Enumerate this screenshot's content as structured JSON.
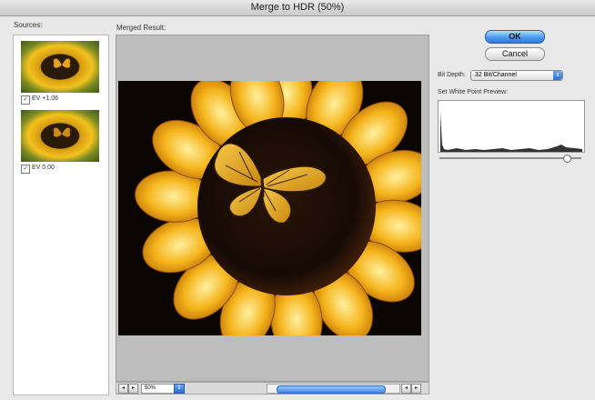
{
  "window": {
    "title": "Merge to HDR (50%)"
  },
  "sources": {
    "label": "Sources:",
    "items": [
      {
        "ev_label": "EV +1.06",
        "checked": true
      },
      {
        "ev_label": "EV 0.00",
        "checked": true
      }
    ]
  },
  "merged": {
    "label": "Merged Result:",
    "zoom": "50%"
  },
  "buttons": {
    "ok": "OK",
    "cancel": "Cancel"
  },
  "bit_depth": {
    "label": "Bit Depth:",
    "value": "32 Bit/Channel"
  },
  "white_point": {
    "label": "Set White Point Preview:",
    "slider_fraction": 0.9
  },
  "colors": {
    "accent": "#3f86e3",
    "photo_yellow": "#f3b41c",
    "photo_dark": "#0b0604"
  },
  "icons": {
    "zoom_menu": "chevron-up-down-icon",
    "scroll_left": "arrow-left-icon",
    "scroll_right": "arrow-right-icon"
  }
}
